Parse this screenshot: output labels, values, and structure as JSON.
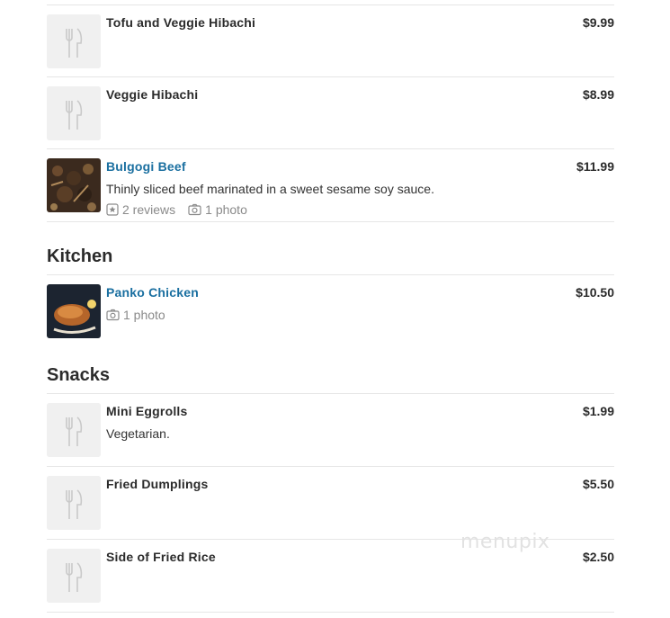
{
  "top_items": [
    {
      "name": "Tofu and Veggie Hibachi",
      "price": "$9.99"
    },
    {
      "name": "Veggie Hibachi",
      "price": "$8.99"
    },
    {
      "name": "Bulgogi Beef",
      "price": "$11.99",
      "description": "Thinly sliced beef marinated in a sweet sesame soy sauce.",
      "reviews": "2 reviews",
      "photos": "1 photo"
    }
  ],
  "kitchen": {
    "title": "Kitchen",
    "items": [
      {
        "name": "Panko Chicken",
        "price": "$10.50",
        "photos": "1 photo"
      }
    ]
  },
  "snacks": {
    "title": "Snacks",
    "items": [
      {
        "name": "Mini Eggrolls",
        "price": "$1.99",
        "description": "Vegetarian."
      },
      {
        "name": "Fried Dumplings",
        "price": "$5.50"
      },
      {
        "name": "Side of Fried Rice",
        "price": "$2.50"
      }
    ]
  },
  "watermark": "menupix",
  "colors": {
    "link": "#1a6fa0",
    "text": "#2b2b2b",
    "muted": "#8a8a8a",
    "divider": "#e6e6e6",
    "placeholder_bg": "#f0f0f0"
  }
}
